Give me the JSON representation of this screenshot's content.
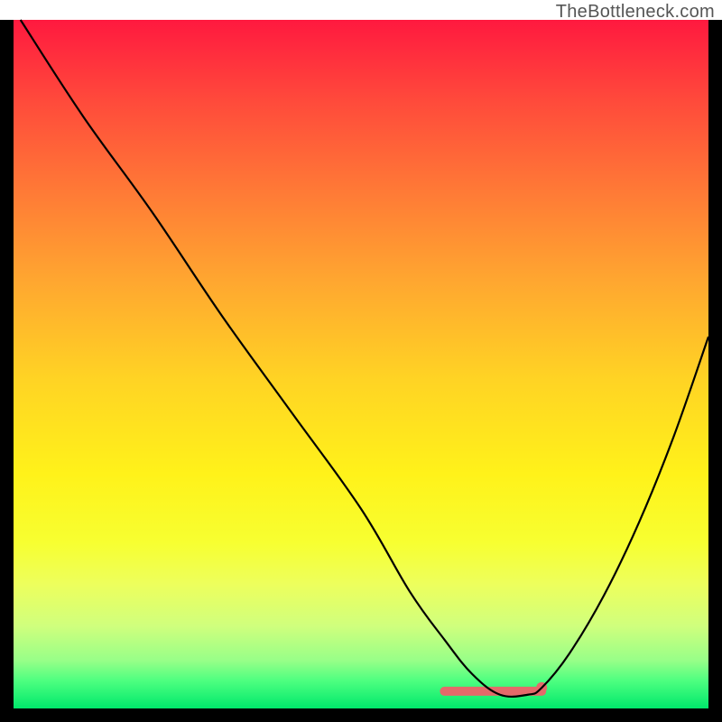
{
  "watermark": "TheBottleneck.com",
  "chart_data": {
    "type": "line",
    "title": "",
    "xlabel": "",
    "ylabel": "",
    "xlim": [
      0,
      100
    ],
    "ylim": [
      0,
      100
    ],
    "series": [
      {
        "name": "curve",
        "x": [
          1,
          10,
          20,
          30,
          40,
          50,
          57,
          62,
          66,
          70,
          74,
          76,
          80,
          85,
          90,
          95,
          100
        ],
        "values": [
          100,
          86,
          72,
          57,
          43,
          29,
          17,
          10,
          5,
          2,
          2,
          3,
          8,
          16.5,
          27,
          39.5,
          54
        ]
      }
    ],
    "flat_region": {
      "x_start": 62,
      "x_end": 76,
      "y": 2.5,
      "color": "#e46a6a",
      "stroke_width": 10
    },
    "curve_color": "#000000",
    "curve_width": 2.2,
    "background_gradient": {
      "top": "#ff193f",
      "bottom": "#00e86b"
    },
    "frame_color": "#000000"
  }
}
